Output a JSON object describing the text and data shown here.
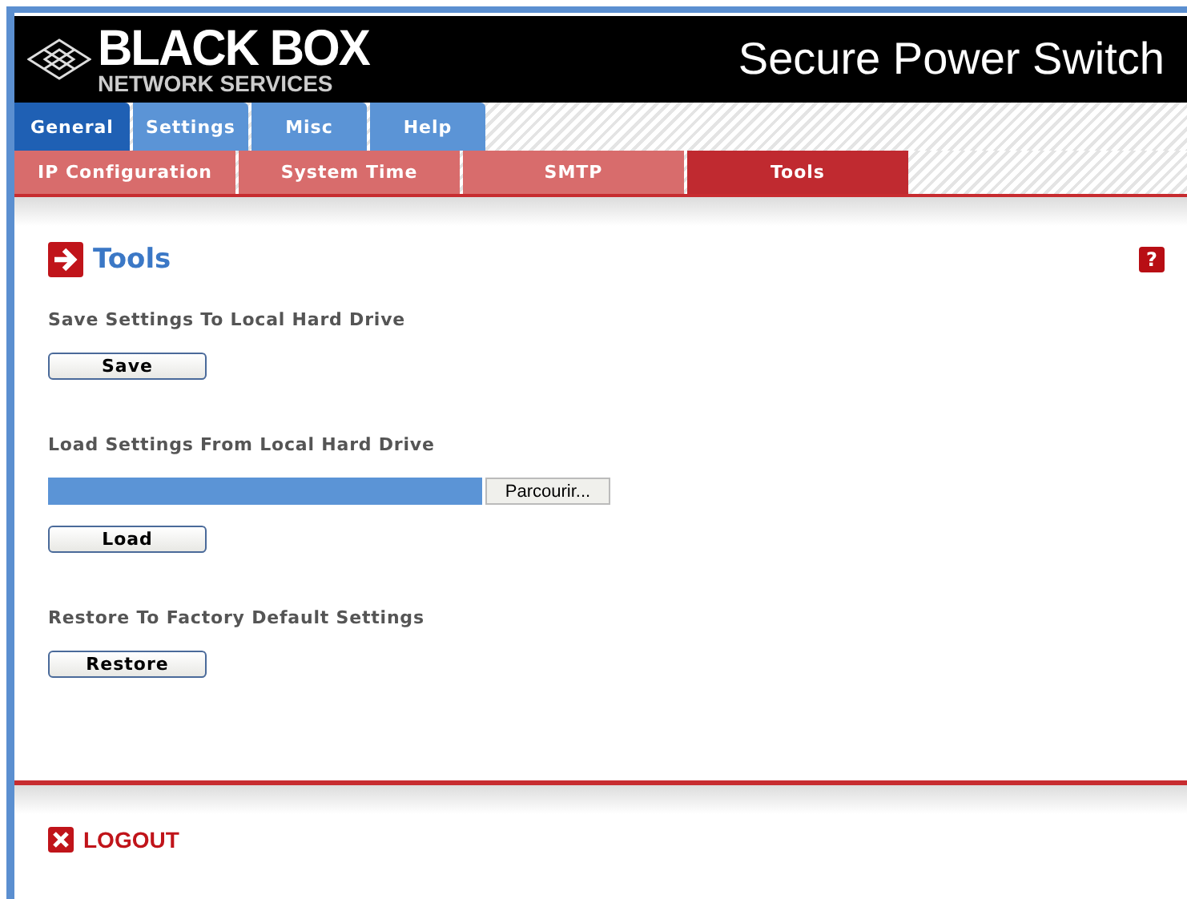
{
  "header": {
    "logo_main": "BLACK BOX",
    "logo_sub": "NETWORK SERVICES",
    "title": "Secure Power Switch"
  },
  "tabs": [
    {
      "label": "General",
      "selected": true
    },
    {
      "label": "Settings",
      "selected": false
    },
    {
      "label": "Misc",
      "selected": false
    },
    {
      "label": "Help",
      "selected": false
    }
  ],
  "subtabs": [
    {
      "label": "IP Configuration",
      "selected": false
    },
    {
      "label": "System Time",
      "selected": false
    },
    {
      "label": "SMTP",
      "selected": false
    },
    {
      "label": "Tools",
      "selected": true
    }
  ],
  "page_title": "Tools",
  "help_glyph": "?",
  "sections": [
    {
      "kind": "button",
      "label": "Save Settings To Local Hard Drive",
      "button": "Save"
    },
    {
      "kind": "file",
      "label": "Load Settings From Local Hard Drive",
      "browse": "Parcourir...",
      "button": "Load"
    },
    {
      "kind": "button",
      "label": "Restore To Factory Default Settings",
      "button": "Restore"
    }
  ],
  "logout": "LOGOUT"
}
